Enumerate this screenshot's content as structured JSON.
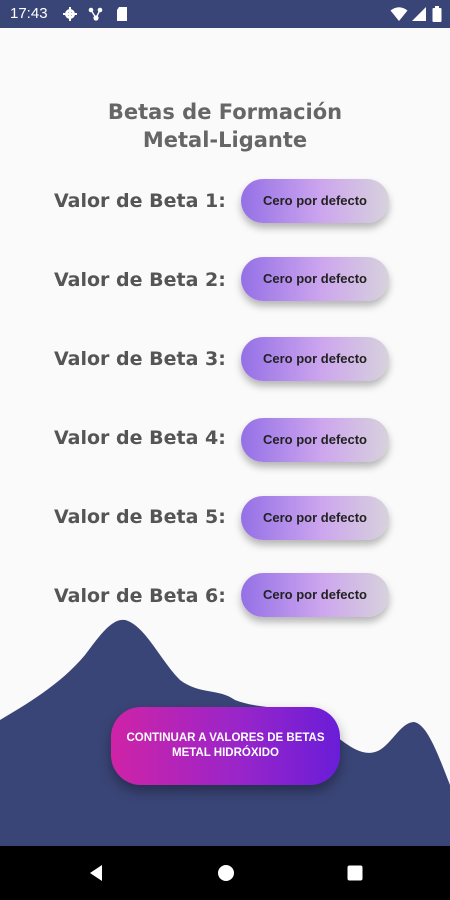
{
  "status_bar": {
    "time": "17:43",
    "background": "#3a4577",
    "icons": [
      "gear-icon",
      "network-icon",
      "sd-card-icon",
      "wifi-icon",
      "signal-icon",
      "battery-icon"
    ]
  },
  "screen": {
    "title_line1": "Betas de Formación",
    "title_line2": "Metal-Ligante",
    "rows": [
      {
        "label": "Valor de Beta 1:",
        "button": "Cero por defecto"
      },
      {
        "label": "Valor de Beta 2:",
        "button": "Cero por defecto"
      },
      {
        "label": "Valor de Beta 3:",
        "button": "Cero por defecto"
      },
      {
        "label": "Valor de Beta 4:",
        "button": "Cero por defecto"
      },
      {
        "label": "Valor de Beta 5:",
        "button": "Cero por defecto"
      },
      {
        "label": "Valor de Beta 6:",
        "button": "Cero por defecto"
      }
    ],
    "continue_button": "CONTINUAR A VALORES DE BETAS METAL HIDRÓXIDO",
    "mountain_color": "#3a4577"
  },
  "nav_bar": {
    "icons": [
      "back-icon",
      "home-icon",
      "recents-icon"
    ]
  }
}
